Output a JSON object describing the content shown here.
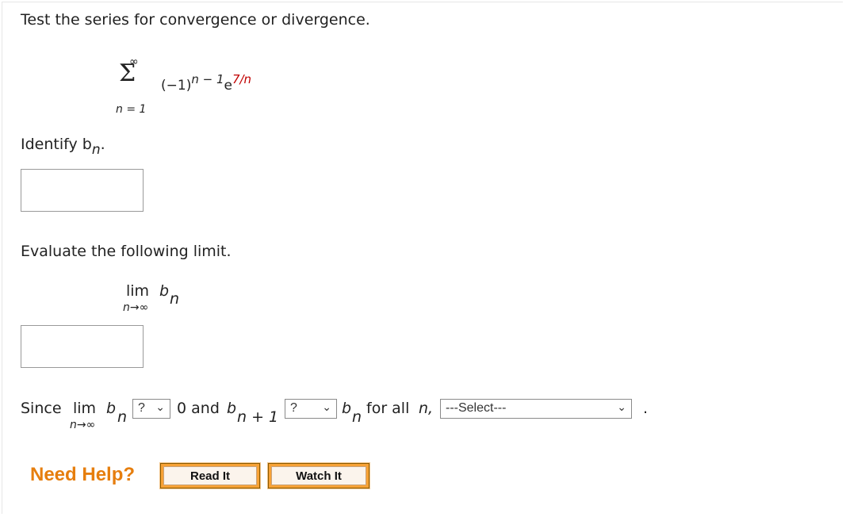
{
  "question": {
    "prompt": "Test the series for convergence or divergence.",
    "series": {
      "upper": "∞",
      "sigma": "Σ",
      "lower": "n = 1",
      "term_base": "(−1)",
      "term_exp": "n − 1",
      "e": "e",
      "e_exp": "7/n"
    },
    "identify_label": "Identify b",
    "identify_sub": "n",
    "identify_end": ".",
    "evaluate_label": "Evaluate the following limit.",
    "limit": {
      "lim": "lim",
      "b": "b",
      "sub": "n",
      "under": "n→∞"
    },
    "since": {
      "since": "Since",
      "lim": "lim",
      "under": "n→∞",
      "b": "b",
      "sub": "n",
      "select1": "?",
      "zero_and": "0 and",
      "b2": "b",
      "sub2": "n + 1",
      "select2": "?",
      "b3": "b",
      "sub3": "n",
      "for_all": "for all",
      "n": "n,",
      "select3": "---Select---",
      "period": "."
    }
  },
  "help": {
    "label": "Need Help?",
    "read_it": "Read It",
    "watch_it": "Watch It"
  },
  "colors": {
    "accent": "#e67e0e",
    "button": "#f7a236",
    "red": "#c00000"
  }
}
